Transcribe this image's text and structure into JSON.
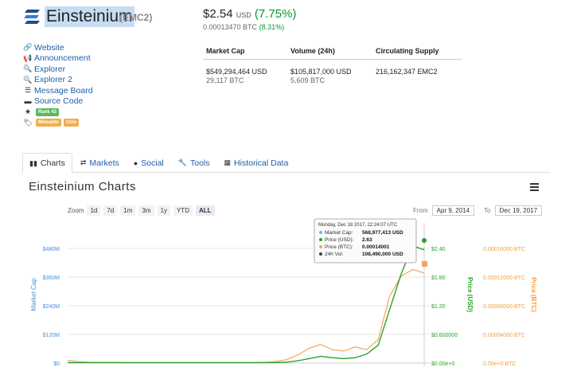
{
  "coin": {
    "name": "Einsteinium",
    "symbol": "(EMC2)",
    "price_usd": "$2.54",
    "currency": "USD",
    "change_usd": "(7.75%)",
    "price_btc": "0.00013470 BTC",
    "change_btc": "(8.31%)"
  },
  "links": [
    {
      "icon": "link-icon",
      "label": "Website"
    },
    {
      "icon": "bullhorn-icon",
      "label": "Announcement"
    },
    {
      "icon": "search-icon",
      "label": "Explorer"
    },
    {
      "icon": "search-icon",
      "label": "Explorer 2"
    },
    {
      "icon": "list-icon",
      "label": "Message Board"
    },
    {
      "icon": "hdd-icon",
      "label": "Source Code"
    }
  ],
  "rank_badge": "Rank 43",
  "tags": [
    "Mineable",
    "Coin"
  ],
  "stats": {
    "headers": [
      "Market Cap",
      "Volume (24h)",
      "Circulating Supply"
    ],
    "market_cap_usd": "$549,294,464 USD",
    "market_cap_btc": "29,117 BTC",
    "volume_usd": "$105,817,000 USD",
    "volume_btc": "5,609 BTC",
    "supply": "216,162,347 EMC2"
  },
  "tabs": [
    {
      "icon": "bar-chart-icon",
      "label": "Charts",
      "active": true
    },
    {
      "icon": "exchange-icon",
      "label": "Markets"
    },
    {
      "icon": "globe-icon",
      "label": "Social"
    },
    {
      "icon": "wrench-icon",
      "label": "Tools"
    },
    {
      "icon": "calendar-icon",
      "label": "Historical Data"
    }
  ],
  "chart_section": {
    "title": "Einsteinium Charts",
    "zoom_label": "Zoom",
    "zoom_options": [
      "1d",
      "7d",
      "1m",
      "3m",
      "1y",
      "YTD",
      "ALL"
    ],
    "zoom_selected": "ALL",
    "from_label": "From",
    "from_date": "Apr 9, 2014",
    "to_label": "To",
    "to_date": "Dec 19, 2017"
  },
  "tooltip": {
    "date": "Monday, Dec 18 2017, 22:24:07 UTC",
    "rows": [
      {
        "label": "Market Cap:",
        "value": "568,977,413 USD",
        "color": "#7cb5ec"
      },
      {
        "label": "Price (USD):",
        "value": "2.63",
        "color": "#2aa22a"
      },
      {
        "label": "Price (BTC):",
        "value": "0.00014001",
        "color": "#f7a35c"
      },
      {
        "label": "24h Vol:",
        "value": "108,490,000 USD",
        "color": "#434348"
      }
    ]
  },
  "chart_data": {
    "type": "line",
    "colors": {
      "market_cap": "#7cb5ec",
      "price_usd": "#2aa22a",
      "price_btc": "#f7a35c"
    },
    "axes": {
      "left": {
        "label": "Market Cap",
        "ticks": [
          "$0",
          "$120M",
          "$240M",
          "$360M",
          "$480M"
        ],
        "range": [
          0,
          600000000
        ]
      },
      "right_usd": {
        "label": "Price (USD)",
        "ticks": [
          "$0.00e+0",
          "$0.600000",
          "$1.20",
          "$1.80",
          "$2.40"
        ],
        "range": [
          0,
          3.0
        ]
      },
      "right_btc": {
        "label": "Price (BTC)",
        "ticks": [
          "0.00e+0 BTC",
          "0.00004000 BTC",
          "0.00008000 BTC",
          "0.00012000 BTC",
          "0.00016000 BTC"
        ],
        "range": [
          0,
          0.0002
        ]
      }
    },
    "series": [
      {
        "name": "Price (USD)",
        "values": [
          0.01,
          0.01,
          0.01,
          0.01,
          0.01,
          0.01,
          0.01,
          0.01,
          0.01,
          0.01,
          0.01,
          0.01,
          0.01,
          0.01,
          0.01,
          0.01,
          0.01,
          0.01,
          0.01,
          0.02,
          0.05,
          0.1,
          0.15,
          0.12,
          0.1,
          0.12,
          0.2,
          0.4,
          1.2,
          2.0,
          2.63,
          2.54
        ]
      },
      {
        "name": "Price (BTC)",
        "values": [
          4e-06,
          2e-06,
          1e-06,
          1e-06,
          1e-06,
          5e-07,
          5e-07,
          5e-07,
          5e-07,
          5e-07,
          5e-07,
          5e-07,
          5e-07,
          5e-07,
          5e-07,
          5e-07,
          5e-07,
          1e-06,
          2e-06,
          5e-06,
          1.2e-05,
          2.2e-05,
          2.8e-05,
          2e-05,
          1.8e-05,
          2.4e-05,
          2e-05,
          3.5e-05,
          0.0001,
          0.00013,
          0.00014001,
          0.0001347
        ]
      }
    ]
  }
}
